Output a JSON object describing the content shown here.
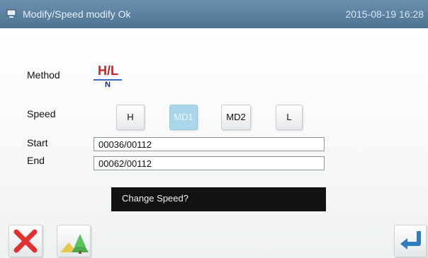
{
  "titlebar": {
    "icon": "computer-icon",
    "title": "Modify/Speed modify  Ok",
    "datetime": "2015-08-19 16:28"
  },
  "form": {
    "method_label": "Method",
    "method_icon": {
      "name": "hl-method-icon",
      "top": "H/L",
      "bottom": "N"
    },
    "speed_label": "Speed",
    "speed_options": [
      "H",
      "MD1",
      "MD2",
      "L"
    ],
    "speed_selected": "MD1",
    "start_label": "Start",
    "start_value": "00036/00112",
    "end_label": "End",
    "end_value": "00062/00112"
  },
  "dialog": {
    "message": "Change Speed?"
  },
  "buttons": {
    "cancel_icon": "red-x-icon",
    "pattern_icon": "tree-icon",
    "enter_icon": "enter-arrow-icon"
  },
  "colors": {
    "titlebar": "#5b7f9f",
    "selected_button": "#a9d6ea",
    "dialog_background": "#121212",
    "cancel_red": "#e03030",
    "enter_blue": "#2f7fc0"
  }
}
